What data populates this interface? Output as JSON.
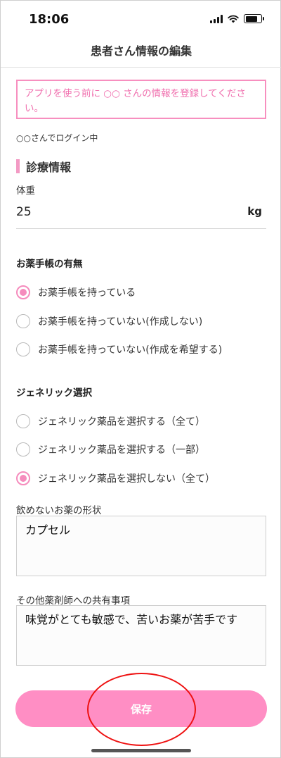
{
  "status_bar": {
    "time": "18:06"
  },
  "header": {
    "title": "患者さん情報の編集"
  },
  "notice": {
    "text": "アプリを使う前に ○○ さんの情報を登録してください。"
  },
  "login_status": "○○さんでログイン中",
  "section": {
    "title": "診療情報"
  },
  "weight": {
    "label": "体重",
    "value": "25",
    "unit": "kg"
  },
  "medicine_notebook": {
    "label": "お薬手帳の有無",
    "options": [
      {
        "label": "お薬手帳を持っている",
        "selected": true
      },
      {
        "label": "お薬手帳を持っていない(作成しない)",
        "selected": false
      },
      {
        "label": "お薬手帳を持っていない(作成を希望する)",
        "selected": false
      }
    ]
  },
  "generic": {
    "label": "ジェネリック選択",
    "options": [
      {
        "label": "ジェネリック薬品を選択する（全て）",
        "selected": false
      },
      {
        "label": "ジェネリック薬品を選択する（一部）",
        "selected": false
      },
      {
        "label": "ジェネリック薬品を選択しない（全て）",
        "selected": true
      }
    ]
  },
  "medicine_form": {
    "label": "飲めないお薬の形状",
    "value": "カプセル"
  },
  "pharmacist_notes": {
    "label": "その他薬剤師への共有事項",
    "value": "味覚がとても敏感で、苦いお薬が苦手です"
  },
  "save_button": {
    "label": "保存"
  },
  "colors": {
    "accent": "#ff8ec4",
    "notice_text": "#f06fae",
    "annotation": "#ee1111"
  }
}
